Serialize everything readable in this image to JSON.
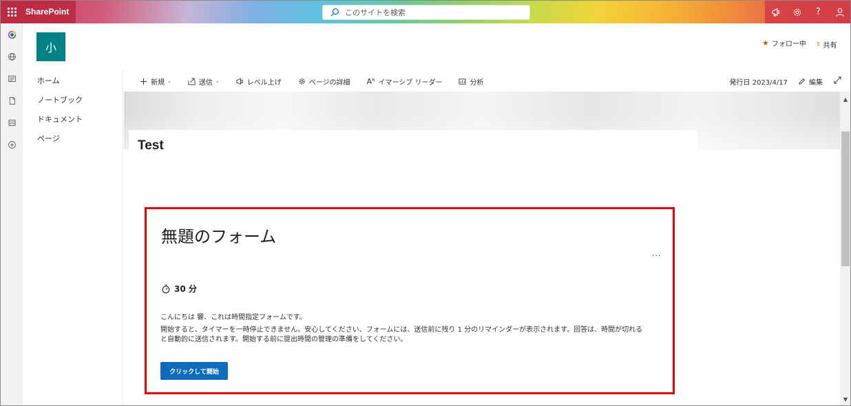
{
  "suite": {
    "brand": "SharePoint",
    "search_placeholder": "このサイトを検索",
    "right_icons": [
      "megaphone-icon",
      "gear-icon",
      "help-icon",
      "person-icon"
    ],
    "help_glyph": "?"
  },
  "appbar": {
    "icons": [
      "sharepoint-home-icon",
      "globe-icon",
      "news-icon",
      "file-icon",
      "list-icon",
      "add-icon"
    ]
  },
  "site": {
    "logo_text": "小",
    "follow_label": "フォロー中",
    "share_label": "共有"
  },
  "nav": {
    "items": [
      {
        "label": "ホーム"
      },
      {
        "label": "ノートブック"
      },
      {
        "label": "ドキュメント"
      },
      {
        "label": "ページ"
      }
    ]
  },
  "commands": {
    "new_label": "新規",
    "send_label": "送信",
    "promote_label": "レベル上げ",
    "details_label": "ページの詳細",
    "reader_label": "イマーシブ リーダー",
    "analytics_label": "分析",
    "published_label": "発行日 2023/4/17",
    "edit_label": "編集",
    "reader_glyph": "Aʱ"
  },
  "page": {
    "title": "Test"
  },
  "form": {
    "title": "無題のフォーム",
    "more": "...",
    "timer": "30 分",
    "greeting": "こんにちは 響、これは時間指定フォームです。",
    "description": "開始すると、タイマーを一時停止できません。安心してください、フォームには、送信前に残り 1 分のリマインダーが表示されます。回答は、時間が切れると自動的に送信されます。開始する前に提出時間の管理の準備をしてください。",
    "start_button": "クリックして開始"
  },
  "colors": {
    "accent": "#0f6cbd",
    "site_logo": "#038387",
    "highlight_border": "#e00000",
    "follow_star": "#c05b14"
  }
}
